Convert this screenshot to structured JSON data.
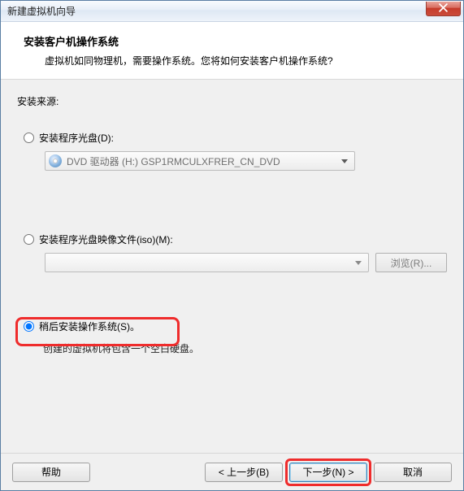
{
  "window": {
    "title": "新建虚拟机向导"
  },
  "header": {
    "title": "安装客户机操作系统",
    "subtitle": "虚拟机如同物理机，需要操作系统。您将如何安装客户机操作系统?"
  },
  "source": {
    "label": "安装来源:",
    "options": {
      "disc": {
        "label": "安装程序光盘(D):",
        "selected_drive": "DVD 驱动器 (H:) GSP1RMCULXFRER_CN_DVD",
        "selected": false
      },
      "iso": {
        "label": "安装程序光盘映像文件(iso)(M):",
        "path": "",
        "browse_label": "浏览(R)...",
        "selected": false
      },
      "later": {
        "label": "稍后安装操作系统(S)。",
        "hint": "创建的虚拟机将包含一个空白硬盘。",
        "selected": true
      }
    }
  },
  "footer": {
    "help": "帮助",
    "back": "< 上一步(B)",
    "next": "下一步(N) >",
    "cancel": "取消"
  }
}
